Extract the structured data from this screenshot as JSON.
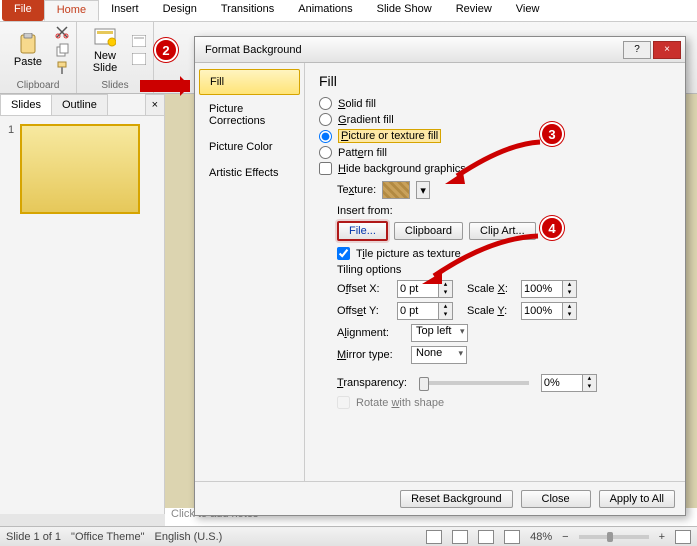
{
  "tabs": {
    "file": "File",
    "home": "Home",
    "insert": "Insert",
    "design": "Design",
    "transitions": "Transitions",
    "animations": "Animations",
    "slideshow": "Slide Show",
    "review": "Review",
    "view": "View"
  },
  "ribbon": {
    "paste": "Paste",
    "clipboard_group": "Clipboard",
    "new_slide": "New\nSlide",
    "slides_group": "Slides"
  },
  "callouts": {
    "c2": "2",
    "c3": "3",
    "c4": "4"
  },
  "sidepane": {
    "slides": "Slides",
    "outline": "Outline",
    "close": "×",
    "num": "1"
  },
  "notes_placeholder": "Click to add notes",
  "status": {
    "slide": "Slide 1 of 1",
    "theme": "\"Office Theme\"",
    "lang": "English (U.S.)",
    "zoom": "48%"
  },
  "dialog": {
    "title": "Format Background",
    "help": "?",
    "close": "×",
    "side": {
      "fill": "Fill",
      "pic_corr": "Picture Corrections",
      "pic_color": "Picture Color",
      "artistic": "Artistic Effects"
    },
    "heading": "Fill",
    "opts": {
      "solid": "Solid fill",
      "gradient": "Gradient fill",
      "pictex": "Picture or texture fill",
      "pattern": "Pattern fill",
      "hide": "Hide background graphics"
    },
    "texture_label": "Texture:",
    "insert_from": "Insert from:",
    "btn_file": "File...",
    "btn_clip": "Clipboard",
    "btn_clipart": "Clip Art...",
    "tile_label": "Tile picture as texture",
    "tiling_heading": "Tiling options",
    "offset_x": "Offset X:",
    "offset_y": "Offset Y:",
    "scale_x": "Scale X:",
    "scale_y": "Scale Y:",
    "val_pt": "0 pt",
    "val_pct": "100%",
    "alignment": "Alignment:",
    "align_val": "Top left",
    "mirror": "Mirror type:",
    "mirror_val": "None",
    "transparency": "Transparency:",
    "transp_val": "0%",
    "rotate": "Rotate with shape",
    "reset": "Reset Background",
    "close_btn": "Close",
    "apply_all": "Apply to All"
  }
}
